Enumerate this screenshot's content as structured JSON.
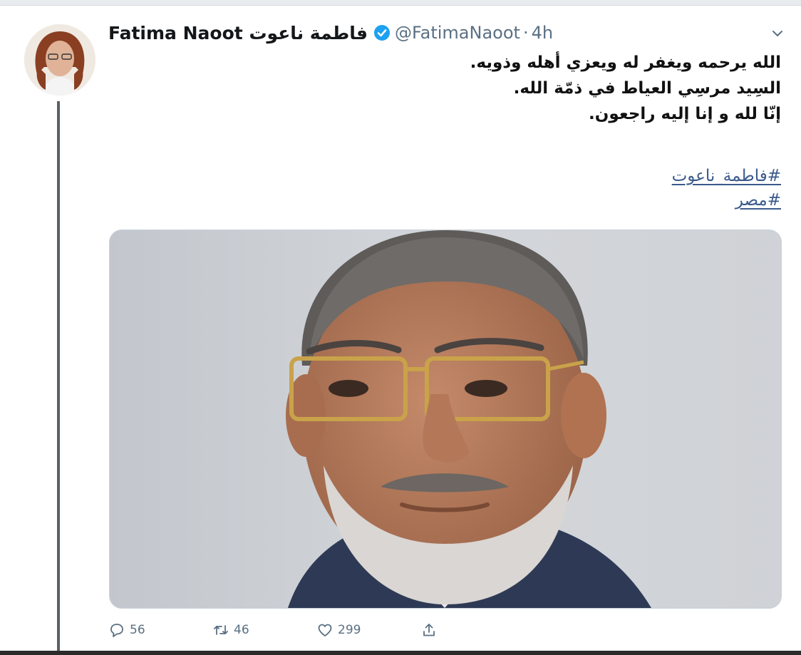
{
  "tweet": {
    "author": {
      "display_name": "Fatima Naoot فاطمة ناعوت",
      "handle": "@FatimaNaoot",
      "verified": true,
      "avatar_icon": "author-avatar"
    },
    "separator": "·",
    "time": "4h",
    "body_lines": [
      "الله يرحمه ويغفر له ويعزي أهله وذويه.",
      "السِيد مرسِي العياط في ذمّة الله.",
      "إنّا لله و إنا إليه راجعون."
    ],
    "hashtags": [
      "#فاطمة_ناعوت",
      "#مصر"
    ],
    "media": {
      "kind": "photo",
      "alt_icon": "portrait-photo"
    },
    "actions": {
      "reply_count": "56",
      "retweet_count": "46",
      "like_count": "299"
    }
  },
  "colors": {
    "text": "#14171a",
    "secondary": "#5b7083",
    "verified": "#1da1f2",
    "link": "#3b5a8c"
  }
}
